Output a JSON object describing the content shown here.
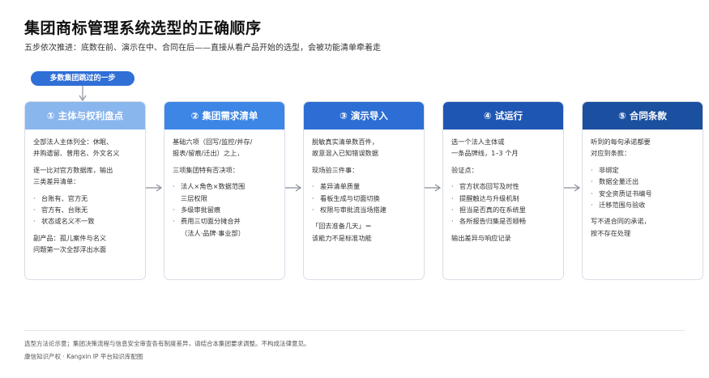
{
  "header": {
    "title": "集团商标管理系统选型的正确顺序",
    "subtitle": "五步依次推进：底数在前、演示在中、合同在后——直接从看产品开始的选型，会被功能清单牵着走"
  },
  "callout": {
    "label": "多数集团跳过的一步"
  },
  "colors": {
    "step1": "#8ab6ee",
    "step2": "#3d86e6",
    "step3": "#2d6ed4",
    "step4": "#1e56b3",
    "step5": "#1b4f9f",
    "pill": "#2f6fd6",
    "arrow": "#8a8f98"
  },
  "steps": [
    {
      "title": "① 主体与权利盘点",
      "p1": [
        "全部法人主体列全：休眠、",
        "并购遗留、曾用名、外文名义"
      ],
      "p2": [
        "逐一比对官方数据库，输出",
        "三类差异清单："
      ],
      "bullets": [
        "台账有、官方无",
        "官方有、台账无",
        "状态或名义不一致"
      ],
      "p3": [
        "副产品：孤儿案件与名义",
        "问题第一次全部浮出水面"
      ]
    },
    {
      "title": "② 集团需求清单",
      "p1": [
        "基础六项（回写/监控/并存/",
        "报表/留痕/迁出）之上，"
      ],
      "p2": [
        "三项集团特有否决项："
      ],
      "bullets": [
        "法人×角色×数据范围",
        "多级审批留痕",
        "费用三切面分摊合并"
      ],
      "bullet_subs": [
        [
          "三层权限"
        ],
        [],
        [
          "（法人·品牌·事业部）"
        ]
      ]
    },
    {
      "title": "③ 演示导入",
      "p1": [
        "脱敏真实清单数百件，",
        "故意混入已知错误数据"
      ],
      "p2": [
        "现场验三件事："
      ],
      "bullets": [
        "差异清单质量",
        "看板生成与切面切换",
        "权限与审批流当场搭建"
      ],
      "p3": [
        "「回去准备几天」＝",
        "该能力不是标准功能"
      ]
    },
    {
      "title": "④ 试运行",
      "p1": [
        "选一个法人主体或",
        "一条品牌线，1–3 个月"
      ],
      "p2": [
        "验证点："
      ],
      "bullets": [
        "官方状态回写及时性",
        "提醒触达与升级机制",
        "担当是否真的在系统里",
        "各所报告归集是否顺畅"
      ],
      "p3": [
        "输出差异与响应记录"
      ]
    },
    {
      "title": "⑤ 合同条款",
      "p1": [
        "听到的每句承诺都要",
        "对应到条款："
      ],
      "bullets": [
        "非绑定",
        "数据全量迁出",
        "安全资质证书编号",
        "迁移范围与验收"
      ],
      "p3": [
        "写不进合同的承诺，",
        "按不存在处理"
      ]
    }
  ],
  "footer": {
    "note": "选型方法论示意；集团决策流程与信息安全审查各有制度差异，请结合本集团要求调整。不构成法律意见。",
    "brand": "康信知识产权 · Kangxin IP 平台知识库配图"
  }
}
